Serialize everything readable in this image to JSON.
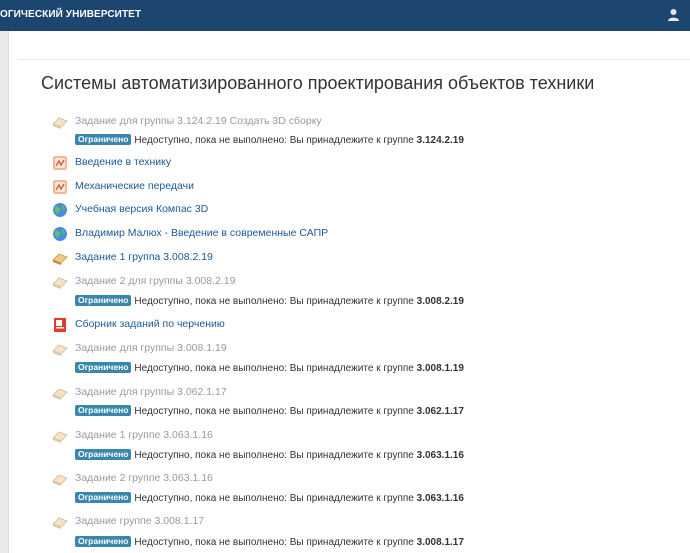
{
  "header": {
    "brand": "ОГИЧЕСКИЙ УНИВЕРСИТЕТ",
    "user_icon": "user-icon"
  },
  "section": {
    "title": "Системы автоматизированного проектирования объектов техники"
  },
  "restriction": {
    "badge": "Ограничено",
    "prefix": "Недоступно, пока не выполнено: Вы принадлежите к группе"
  },
  "activities": [
    {
      "name": "Задание для группы 3.124.2.19 Создать 3D сборку",
      "icon": "assignment-icon",
      "dimmed": true,
      "group": "3.124.2.19"
    },
    {
      "name": "Введение в технику",
      "icon": "pdf-file-icon",
      "dimmed": false
    },
    {
      "name": "Механические передачи",
      "icon": "pdf-file-icon",
      "dimmed": false
    },
    {
      "name": "Учебная версия Компас 3D",
      "icon": "url-globe-icon",
      "dimmed": false
    },
    {
      "name": "Владимир Малюх - Введение в современные САПР",
      "icon": "url-globe-icon",
      "dimmed": false
    },
    {
      "name": "Задание 1 группа 3.008.2.19",
      "icon": "assignment-icon",
      "dimmed": false
    },
    {
      "name": "Задание 2 для группы 3.008.2.19",
      "icon": "assignment-icon",
      "dimmed": true,
      "group": "3.008.2.19"
    },
    {
      "name": "Сборник заданий по черчению",
      "icon": "pdf-document-icon",
      "dimmed": false
    },
    {
      "name": "Задание для группы 3.008.1.19",
      "icon": "assignment-icon",
      "dimmed": true,
      "group": "3.008.1.19"
    },
    {
      "name": "Задание для группы 3.062.1.17",
      "icon": "assignment-icon",
      "dimmed": true,
      "group": "3.062.1.17"
    },
    {
      "name": "Задание 1 группе 3.063.1.16",
      "icon": "assignment-icon",
      "dimmed": true,
      "group": "3.063.1.16"
    },
    {
      "name": "Задание 2 группе 3.063.1.16",
      "icon": "assignment-icon",
      "dimmed": true,
      "group": "3.063.1.16"
    },
    {
      "name": "Задание группе 3.008.1.17",
      "icon": "assignment-icon",
      "dimmed": true,
      "group": "3.008.1.17"
    }
  ]
}
